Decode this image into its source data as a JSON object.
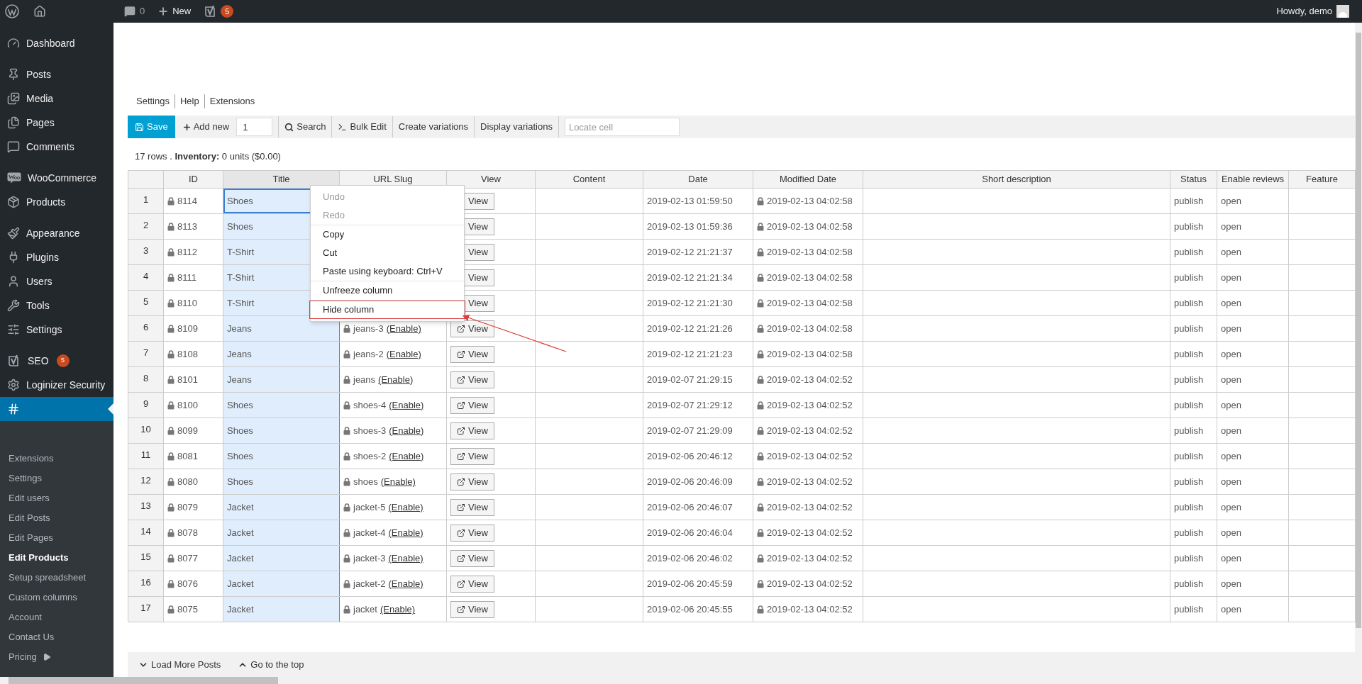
{
  "admin_bar": {
    "comments_count": "0",
    "new_label": "New",
    "seo_badge": "5",
    "greeting": "Howdy, demo"
  },
  "sidebar": {
    "groups": [
      [
        {
          "label": "Dashboard",
          "selected": false
        }
      ],
      [
        {
          "label": "Posts",
          "selected": false
        },
        {
          "label": "Media",
          "selected": false
        },
        {
          "label": "Pages",
          "selected": false
        },
        {
          "label": "Comments",
          "selected": false
        }
      ],
      [
        {
          "label": "WooCommerce",
          "selected": false
        },
        {
          "label": "Products",
          "selected": false
        }
      ],
      [
        {
          "label": "Appearance",
          "selected": false
        },
        {
          "label": "Plugins",
          "selected": false
        },
        {
          "label": "Users",
          "selected": false
        },
        {
          "label": "Tools",
          "selected": false
        },
        {
          "label": "Settings",
          "selected": false
        }
      ],
      [
        {
          "label": "SEO",
          "selected": false,
          "badge": "5"
        },
        {
          "label": "Loginizer Security",
          "selected": false
        },
        {
          "selected": true
        }
      ]
    ],
    "submenu": [
      {
        "label": "Extensions",
        "current": false
      },
      {
        "label": "Settings",
        "current": false
      },
      {
        "label": "Edit users",
        "current": false
      },
      {
        "label": "Edit Posts",
        "current": false
      },
      {
        "label": "Edit Pages",
        "current": false
      },
      {
        "label": "Edit Products",
        "current": true
      },
      {
        "label": "Setup spreadsheet",
        "current": false
      },
      {
        "label": "Custom columns",
        "current": false
      },
      {
        "label": "Account",
        "current": false
      },
      {
        "label": "Contact Us",
        "current": false
      },
      {
        "label": "Pricing",
        "current": false,
        "arrow": true
      }
    ]
  },
  "top_links": [
    "Settings",
    "Help",
    "Extensions"
  ],
  "toolbar": {
    "save": "Save",
    "add_new": "Add new",
    "add_count": "1",
    "search": "Search",
    "bulk_edit": "Bulk Edit",
    "create_variations": "Create variations",
    "display_variations": "Display variations",
    "locate_placeholder": "Locate cell"
  },
  "summary": {
    "rows": "17 rows .",
    "inventory_label": "Inventory:",
    "inventory_value": "0 units ($0.00)"
  },
  "table": {
    "columns": [
      {
        "label": "ID",
        "selected": false
      },
      {
        "label": "Title",
        "selected": true
      },
      {
        "label": "URL Slug",
        "selected": false
      },
      {
        "label": "View",
        "selected": false
      },
      {
        "label": "Content",
        "selected": false
      },
      {
        "label": "Date",
        "selected": false
      },
      {
        "label": "Modified Date",
        "selected": false
      },
      {
        "label": "Short description",
        "selected": false
      },
      {
        "label": "Status",
        "selected": false
      },
      {
        "label": "Enable reviews",
        "selected": false
      },
      {
        "label": "Feature",
        "selected": false
      }
    ],
    "rows": [
      {
        "num": "1",
        "id": "8114",
        "title": "Shoes",
        "title_active": true,
        "view": "View",
        "date": "2019-02-13 01:59:50",
        "modified": "2019-02-13 04:02:58",
        "status": "publish",
        "reviews": "open"
      },
      {
        "num": "2",
        "id": "8113",
        "title": "Shoes",
        "title_active": false,
        "view": "View",
        "date": "2019-02-13 01:59:36",
        "modified": "2019-02-13 04:02:58",
        "status": "publish",
        "reviews": "open"
      },
      {
        "num": "3",
        "id": "8112",
        "title": "T-Shirt",
        "title_active": false,
        "view": "View",
        "date": "2019-02-12 21:21:37",
        "modified": "2019-02-13 04:02:58",
        "status": "publish",
        "reviews": "open"
      },
      {
        "num": "4",
        "id": "8111",
        "title": "T-Shirt",
        "title_active": false,
        "view": "View",
        "date": "2019-02-12 21:21:34",
        "modified": "2019-02-13 04:02:58",
        "status": "publish",
        "reviews": "open"
      },
      {
        "num": "5",
        "id": "8110",
        "title": "T-Shirt",
        "title_active": false,
        "view": "View",
        "date": "2019-02-12 21:21:30",
        "modified": "2019-02-13 04:02:58",
        "status": "publish",
        "reviews": "open"
      },
      {
        "num": "6",
        "id": "8109",
        "title": "Jeans",
        "title_active": false,
        "slug": "jeans-3",
        "slug_link": "(Enable)",
        "view": "View",
        "date": "2019-02-12 21:21:26",
        "modified": "2019-02-13 04:02:58",
        "status": "publish",
        "reviews": "open"
      },
      {
        "num": "7",
        "id": "8108",
        "title": "Jeans",
        "title_active": false,
        "slug": "jeans-2",
        "slug_link": "(Enable)",
        "view": "View",
        "date": "2019-02-12 21:21:23",
        "modified": "2019-02-13 04:02:58",
        "status": "publish",
        "reviews": "open"
      },
      {
        "num": "8",
        "id": "8101",
        "title": "Jeans",
        "title_active": false,
        "slug": "jeans",
        "slug_link": "(Enable)",
        "view": "View",
        "date": "2019-02-07 21:29:15",
        "modified": "2019-02-13 04:02:52",
        "status": "publish",
        "reviews": "open"
      },
      {
        "num": "9",
        "id": "8100",
        "title": "Shoes",
        "title_active": false,
        "slug": "shoes-4",
        "slug_link": "(Enable)",
        "view": "View",
        "date": "2019-02-07 21:29:12",
        "modified": "2019-02-13 04:02:52",
        "status": "publish",
        "reviews": "open"
      },
      {
        "num": "10",
        "id": "8099",
        "title": "Shoes",
        "title_active": false,
        "slug": "shoes-3",
        "slug_link": "(Enable)",
        "view": "View",
        "date": "2019-02-07 21:29:09",
        "modified": "2019-02-13 04:02:52",
        "status": "publish",
        "reviews": "open"
      },
      {
        "num": "11",
        "id": "8081",
        "title": "Shoes",
        "title_active": false,
        "slug": "shoes-2",
        "slug_link": "(Enable)",
        "view": "View",
        "date": "2019-02-06 20:46:12",
        "modified": "2019-02-13 04:02:52",
        "status": "publish",
        "reviews": "open"
      },
      {
        "num": "12",
        "id": "8080",
        "title": "Shoes",
        "title_active": false,
        "slug": "shoes",
        "slug_link": "(Enable)",
        "view": "View",
        "date": "2019-02-06 20:46:09",
        "modified": "2019-02-13 04:02:52",
        "status": "publish",
        "reviews": "open"
      },
      {
        "num": "13",
        "id": "8079",
        "title": "Jacket",
        "title_active": false,
        "slug": "jacket-5",
        "slug_link": "(Enable)",
        "view": "View",
        "date": "2019-02-06 20:46:07",
        "modified": "2019-02-13 04:02:52",
        "status": "publish",
        "reviews": "open"
      },
      {
        "num": "14",
        "id": "8078",
        "title": "Jacket",
        "title_active": false,
        "slug": "jacket-4",
        "slug_link": "(Enable)",
        "view": "View",
        "date": "2019-02-06 20:46:04",
        "modified": "2019-02-13 04:02:52",
        "status": "publish",
        "reviews": "open"
      },
      {
        "num": "15",
        "id": "8077",
        "title": "Jacket",
        "title_active": false,
        "slug": "jacket-3",
        "slug_link": "(Enable)",
        "view": "View",
        "date": "2019-02-06 20:46:02",
        "modified": "2019-02-13 04:02:52",
        "status": "publish",
        "reviews": "open"
      },
      {
        "num": "16",
        "id": "8076",
        "title": "Jacket",
        "title_active": false,
        "slug": "jacket-2",
        "slug_link": "(Enable)",
        "view": "View",
        "date": "2019-02-06 20:45:59",
        "modified": "2019-02-13 04:02:52",
        "status": "publish",
        "reviews": "open"
      },
      {
        "num": "17",
        "id": "8075",
        "title": "Jacket",
        "title_active": false,
        "slug": "jacket",
        "slug_link": "(Enable)",
        "view": "View",
        "date": "2019-02-06 20:45:55",
        "modified": "2019-02-13 04:02:52",
        "status": "publish",
        "reviews": "open"
      }
    ]
  },
  "context_menu": {
    "groups": [
      {
        "disabled": true,
        "items": [
          {
            "label": "Undo",
            "highlighted": false
          },
          {
            "label": "Redo",
            "highlighted": false
          }
        ]
      },
      {
        "disabled": false,
        "items": [
          {
            "label": "Copy",
            "highlighted": false
          },
          {
            "label": "Cut",
            "highlighted": false
          },
          {
            "label": "Paste using keyboard: Ctrl+V",
            "highlighted": false
          }
        ]
      },
      {
        "disabled": false,
        "items": [
          {
            "label": "Unfreeze column",
            "highlighted": false
          }
        ]
      },
      {
        "disabled": false,
        "items": [
          {
            "label": "Hide column",
            "highlighted": true
          }
        ]
      }
    ]
  },
  "footer": {
    "load_more": "Load More Posts",
    "go_top": "Go to the top"
  }
}
